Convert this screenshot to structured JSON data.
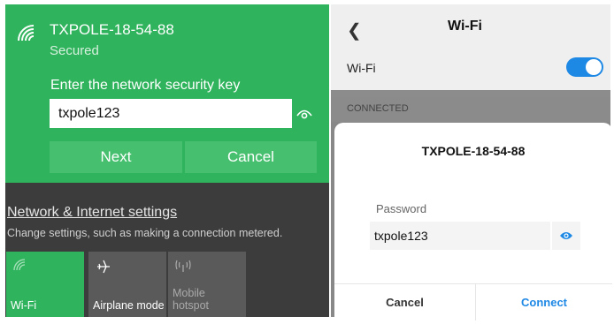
{
  "windows_flyout": {
    "network_name": "TXPOLE-18-54-88",
    "network_status": "Secured",
    "key_prompt": "Enter the network security key",
    "key_value": "txpole123",
    "reveal_icon": "eye-icon",
    "next_label": "Next",
    "cancel_label": "Cancel",
    "settings_link": "Network & Internet settings",
    "settings_desc": "Change settings, such as making a connection metered.",
    "tiles": [
      {
        "label": "Wi-Fi",
        "icon": "wifi-icon",
        "active": true
      },
      {
        "label": "Airplane mode",
        "icon": "airplane-icon",
        "active": false
      },
      {
        "label_line1": "Mobile",
        "label_line2": "hotspot",
        "icon": "hotspot-icon",
        "active": false
      }
    ],
    "accent_color": "#2fb35c"
  },
  "android": {
    "back_icon": "back-chevron-icon",
    "title": "Wi-Fi",
    "wifi_toggle_label": "Wi-Fi",
    "wifi_toggle_on": true,
    "section_label": "CONNECTED",
    "dialog": {
      "title": "TXPOLE-18-54-88",
      "password_label": "Password",
      "password_value": "txpole123",
      "eye_icon": "eye-icon",
      "cancel_label": "Cancel",
      "connect_label": "Connect"
    },
    "accent_color": "#1e88e5"
  }
}
